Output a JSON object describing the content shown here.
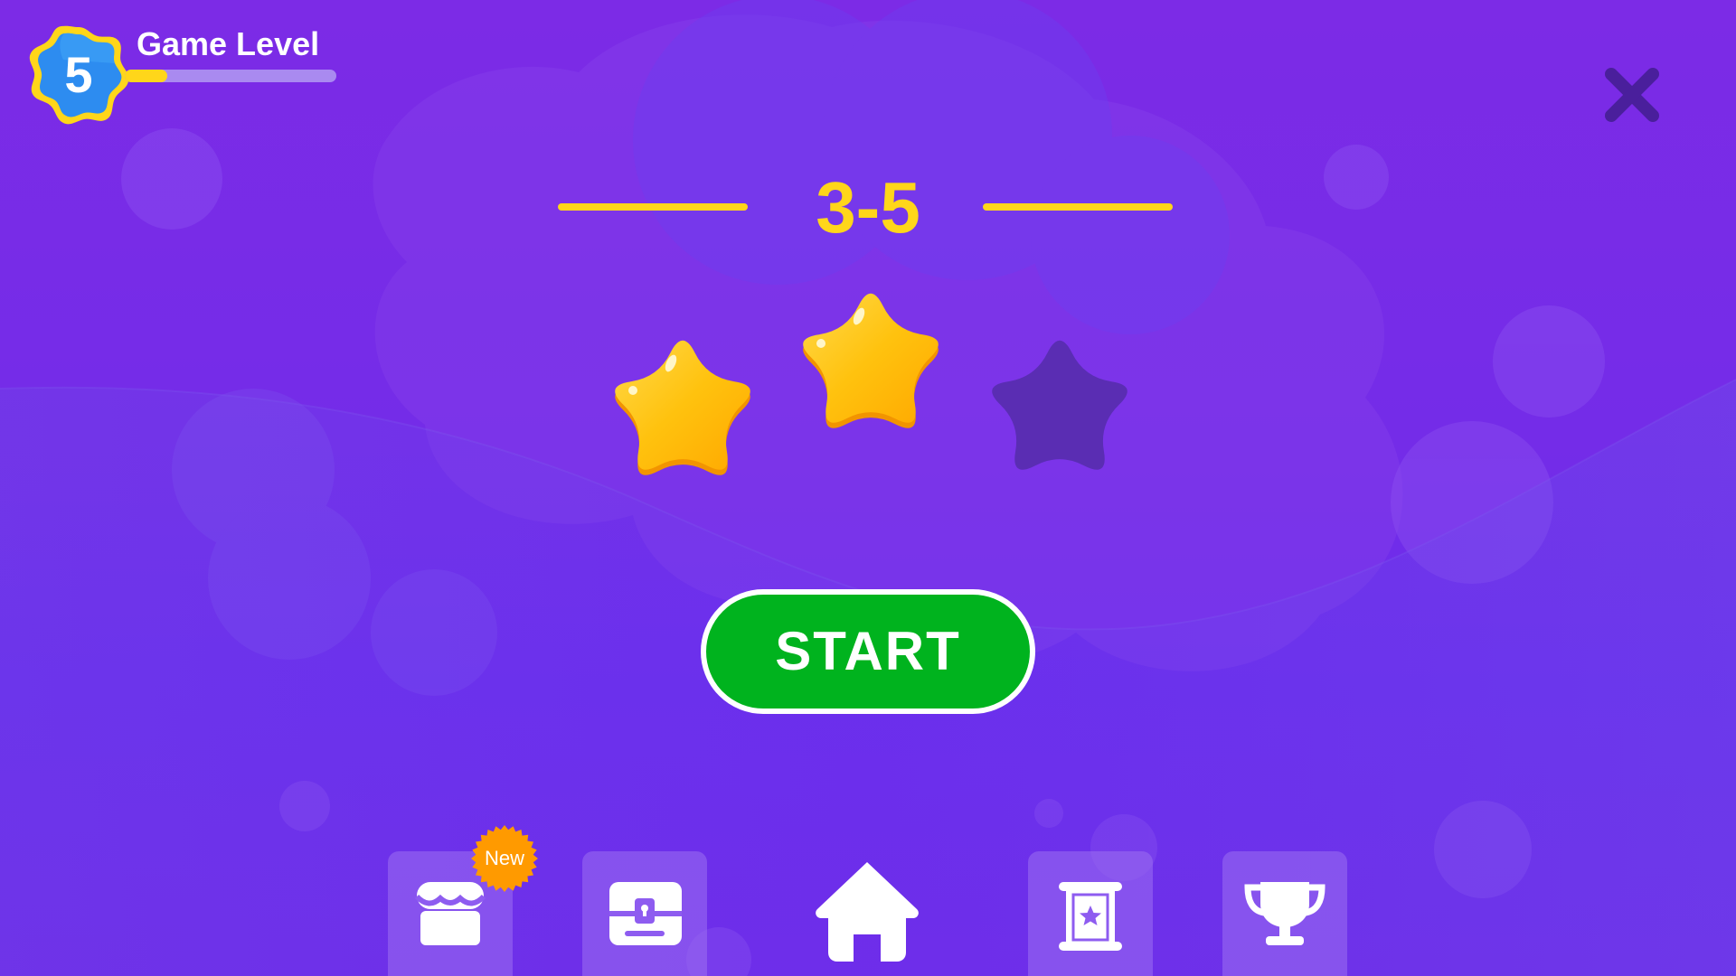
{
  "player": {
    "level": "5",
    "title": "Game Level",
    "progress": 0.2
  },
  "stage": {
    "label": "3-5",
    "stars_earned": 2,
    "stars_total": 3
  },
  "actions": {
    "start_label": "START",
    "close_icon": "close-icon"
  },
  "nav": {
    "items": [
      {
        "name": "shop",
        "icon": "shop-icon",
        "badge": "New"
      },
      {
        "name": "treasure",
        "icon": "chest-icon"
      },
      {
        "name": "home",
        "icon": "home-icon",
        "active": true
      },
      {
        "name": "quests",
        "icon": "scroll-icon"
      },
      {
        "name": "trophies",
        "icon": "trophy-icon"
      }
    ]
  },
  "colors": {
    "background": "#7a2ae6",
    "accent_yellow": "#ffd61a",
    "start_green": "#00b31e",
    "star_gold": "#ffc20e",
    "star_empty": "#5a2db3",
    "badge_blue": "#2d8cf0",
    "new_badge_orange": "#ff9a00"
  }
}
